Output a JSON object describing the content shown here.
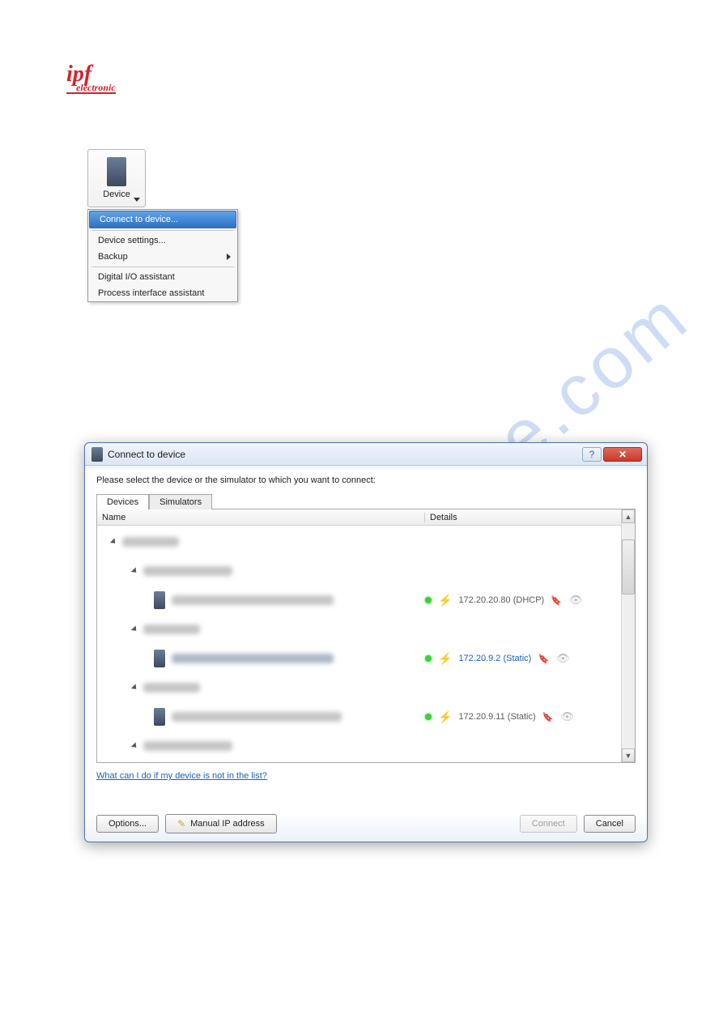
{
  "logo": {
    "main": "ipf",
    "sub": "electronic"
  },
  "device_button": {
    "label": "Device"
  },
  "menu": {
    "items": [
      {
        "label": "Connect to device...",
        "selected": true
      },
      {
        "label": "Device settings..."
      },
      {
        "label": "Backup",
        "submenu": true
      },
      {
        "label": "Digital I/O assistant"
      },
      {
        "label": "Process interface assistant"
      }
    ]
  },
  "dialog": {
    "title": "Connect to device",
    "prompt": "Please select the device or the simulator to which you want to connect:",
    "tabs": {
      "devices": "Devices",
      "simulators": "Simulators"
    },
    "columns": {
      "name": "Name",
      "details": "Details"
    },
    "rows": [
      {
        "ip": "172.20.20.80 (DHCP)",
        "active": false
      },
      {
        "ip": "172.20.9.2 (Static)",
        "active": true
      },
      {
        "ip": "172.20.9.11 (Static)",
        "active": false
      }
    ],
    "help_link": "What can I do if my device is not in the list?",
    "buttons": {
      "options": "Options...",
      "manual_ip": "Manual IP address",
      "connect": "Connect",
      "cancel": "Cancel"
    }
  },
  "watermark": "manualshive.com"
}
